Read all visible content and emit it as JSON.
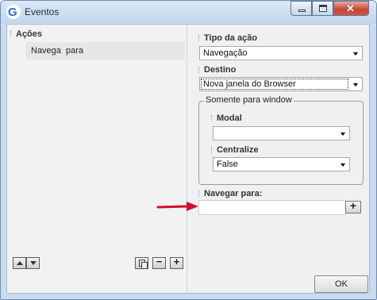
{
  "window": {
    "title": "Eventos",
    "app_icon_letter": "G",
    "controls": {
      "minimize": "minimize-icon",
      "maximize": "maximize-icon",
      "close": "close-icon",
      "close_glyph": "✕"
    }
  },
  "left": {
    "header": "Ações",
    "items": [
      {
        "label": "Navega  para"
      }
    ],
    "buttons": {
      "move_up": "arrow-up-icon",
      "move_down": "arrow-down-icon",
      "copy": "copy-icon",
      "remove": "−",
      "add": "+"
    }
  },
  "right": {
    "tipo_acao": {
      "label": "Tipo da ação",
      "value": "Navegação"
    },
    "destino": {
      "label": "Destino",
      "value": "Nova janela do Browser"
    },
    "window_group": {
      "title": "Somente para window",
      "modal": {
        "label": "Modal",
        "value": ""
      },
      "centralize": {
        "label": "Centralize",
        "value": "False"
      }
    },
    "navegar_para": {
      "label": "Navegar para:",
      "value": "",
      "add": "+"
    }
  },
  "annotation": {
    "color": "#d0102a"
  },
  "footer": {
    "ok": "OK"
  }
}
